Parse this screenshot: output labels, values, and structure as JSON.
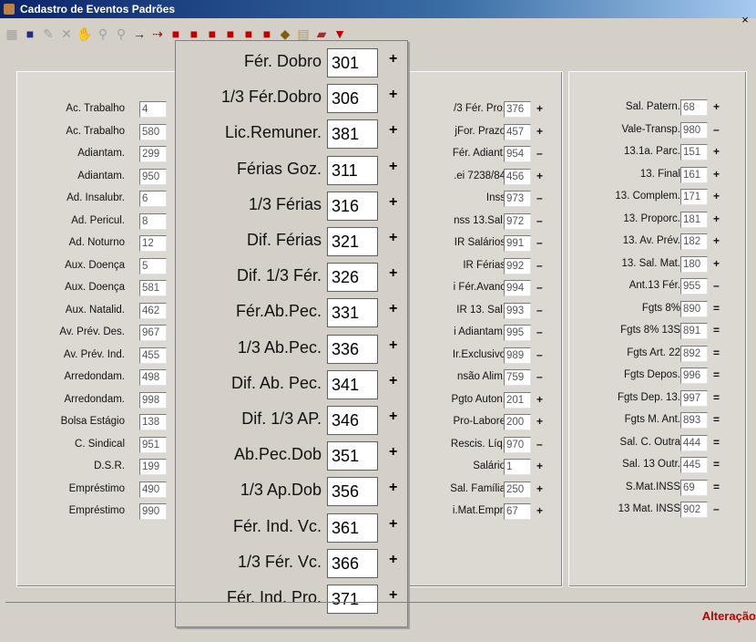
{
  "window": {
    "title": "Cadastro de Eventos Padrões",
    "close": "×"
  },
  "toolbar": {
    "icons": [
      "grid-icon",
      "save-icon",
      "edit-icon",
      "delete-icon",
      "cancel-icon",
      "search-icon",
      "find-icon",
      "arrow-right-icon",
      "arrow-red-icon",
      "box-icon",
      "box-icon",
      "box-icon",
      "box-icon",
      "box-icon",
      "box-icon",
      "tag-icon",
      "report-icon",
      "folder-icon",
      "exit-icon"
    ]
  },
  "left_column": [
    {
      "label": "Ac. Trabalho",
      "code": "4"
    },
    {
      "label": "Ac. Trabalho",
      "code": "580"
    },
    {
      "label": "Adiantam.",
      "code": "299"
    },
    {
      "label": "Adiantam.",
      "code": "950"
    },
    {
      "label": "Ad. Insalubr.",
      "code": "6"
    },
    {
      "label": "Ad. Pericul.",
      "code": "8"
    },
    {
      "label": "Ad. Noturno",
      "code": "12"
    },
    {
      "label": "Aux. Doença",
      "code": "5"
    },
    {
      "label": "Aux. Doença",
      "code": "581"
    },
    {
      "label": "Aux. Natalid.",
      "code": "462"
    },
    {
      "label": "Av. Prév. Des.",
      "code": "967"
    },
    {
      "label": "Av. Prév. Ind.",
      "code": "455"
    },
    {
      "label": "Arredondam.",
      "code": "498"
    },
    {
      "label": "Arredondam.",
      "code": "998"
    },
    {
      "label": "Bolsa Estágio",
      "code": "138"
    },
    {
      "label": "C. Sindical",
      "code": "951"
    },
    {
      "label": "D.S.R.",
      "code": "199"
    },
    {
      "label": "Empréstimo",
      "code": "490"
    },
    {
      "label": "Empréstimo",
      "code": "990"
    }
  ],
  "popup_rows": [
    {
      "label": "Fér. Dobro",
      "code": "301",
      "sign": "+"
    },
    {
      "label": "1/3 Fér.Dobro",
      "code": "306",
      "sign": "+"
    },
    {
      "label": "Lic.Remuner.",
      "code": "381",
      "sign": "+"
    },
    {
      "label": "Férias Goz.",
      "code": "311",
      "sign": "+"
    },
    {
      "label": "1/3 Férias",
      "code": "316",
      "sign": "+"
    },
    {
      "label": "Dif. Férias",
      "code": "321",
      "sign": "+"
    },
    {
      "label": "Dif. 1/3 Fér.",
      "code": "326",
      "sign": "+"
    },
    {
      "label": "Fér.Ab.Pec.",
      "code": "331",
      "sign": "+"
    },
    {
      "label": "1/3 Ab.Pec.",
      "code": "336",
      "sign": "+"
    },
    {
      "label": "Dif. Ab. Pec.",
      "code": "341",
      "sign": "+"
    },
    {
      "label": "Dif. 1/3 AP.",
      "code": "346",
      "sign": "+"
    },
    {
      "label": "Ab.Pec.Dob",
      "code": "351",
      "sign": "+"
    },
    {
      "label": "1/3 Ap.Dob",
      "code": "356",
      "sign": "+"
    },
    {
      "label": "Fér. Ind. Vc.",
      "code": "361",
      "sign": "+"
    },
    {
      "label": "1/3 Fér. Vc.",
      "code": "366",
      "sign": "+"
    },
    {
      "label": "Fér. Ind. Pro.",
      "code": "371",
      "sign": "+"
    }
  ],
  "middle_column": [
    {
      "label": "/3 Fér. Pro.",
      "code": "376",
      "sign": "+"
    },
    {
      "label": "jFor. Prazo",
      "code": "457",
      "sign": "+"
    },
    {
      "label": "Fér. Adiant.",
      "code": "954",
      "sign": "–"
    },
    {
      "label": ".ei 7238/84",
      "code": "456",
      "sign": "+"
    },
    {
      "label": "Inss",
      "code": "973",
      "sign": "–"
    },
    {
      "label": "nss 13.Sal.",
      "code": "972",
      "sign": "–"
    },
    {
      "label": "IR Salários",
      "code": "991",
      "sign": "–"
    },
    {
      "label": "IR Férias",
      "code": "992",
      "sign": "–"
    },
    {
      "label": "i Fér.Avanc",
      "code": "994",
      "sign": "–"
    },
    {
      "label": "IR 13. Sal.",
      "code": "993",
      "sign": "–"
    },
    {
      "label": "i Adiantam.",
      "code": "995",
      "sign": "–"
    },
    {
      "label": "Ir.Exclusivo",
      "code": "989",
      "sign": "–"
    },
    {
      "label": "nsão Alim.",
      "code": "759",
      "sign": "–"
    },
    {
      "label": "Pgto Auton.",
      "code": "201",
      "sign": "+"
    },
    {
      "label": "Pro-Labore",
      "code": "200",
      "sign": "+"
    },
    {
      "label": "Rescis. Líq.",
      "code": "970",
      "sign": "–"
    },
    {
      "label": "Salário",
      "code": "1",
      "sign": "+"
    },
    {
      "label": "Sal. Família",
      "code": "250",
      "sign": "+"
    },
    {
      "label": "i.Mat.Empr.",
      "code": "67",
      "sign": "+"
    }
  ],
  "right_column": [
    {
      "label": "Sal. Patern.",
      "code": "68",
      "sign": "+"
    },
    {
      "label": "Vale-Transp.",
      "code": "980",
      "sign": "–"
    },
    {
      "label": "13.1a. Parc.",
      "code": "151",
      "sign": "+"
    },
    {
      "label": "13. Final",
      "code": "161",
      "sign": "+"
    },
    {
      "label": "13. Complem.",
      "code": "171",
      "sign": "+"
    },
    {
      "label": "13. Proporc.",
      "code": "181",
      "sign": "+"
    },
    {
      "label": "13. Av. Prév.",
      "code": "182",
      "sign": "+"
    },
    {
      "label": "13. Sal. Mat.",
      "code": "180",
      "sign": "+"
    },
    {
      "label": "Ant.13 Fér.",
      "code": "955",
      "sign": "–"
    },
    {
      "label": "Fgts 8%",
      "code": "890",
      "sign": "="
    },
    {
      "label": "Fgts 8% 13S",
      "code": "891",
      "sign": "="
    },
    {
      "label": "Fgts Art. 22",
      "code": "892",
      "sign": "="
    },
    {
      "label": "Fgts Depos.",
      "code": "996",
      "sign": "="
    },
    {
      "label": "Fgts Dep. 13.",
      "code": "997",
      "sign": "="
    },
    {
      "label": "Fgts M. Ant.",
      "code": "893",
      "sign": "="
    },
    {
      "label": "Sal. C. Outra",
      "code": "444",
      "sign": "="
    },
    {
      "label": "Sal. 13 Outr.",
      "code": "445",
      "sign": "="
    },
    {
      "label": "S.Mat.INSS",
      "code": "69",
      "sign": "="
    },
    {
      "label": "13 Mat. INSS",
      "code": "902",
      "sign": "–"
    }
  ],
  "status": {
    "mode": "Alteração"
  },
  "colors": {
    "title_bar": "#0a246a",
    "status_text": "#c00000",
    "form_bg": "#d4d0c8"
  }
}
